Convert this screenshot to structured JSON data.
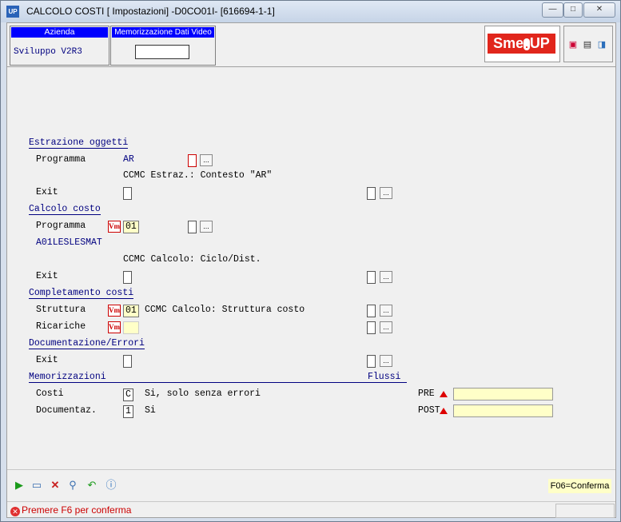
{
  "window": {
    "app_icon": "UP",
    "title": "CALCOLO COSTI [ Impostazioni] -D0CO01I- [616694-1-1]",
    "minimize": "—",
    "maximize": "□",
    "close": "✕"
  },
  "header": {
    "azienda_label": "Azienda",
    "azienda_value": "Sviluppo V2R3",
    "memo_label": "Memorizzazione Dati Video",
    "memo_value": "",
    "logo_text_left": "Sme",
    "logo_text_right": "UP"
  },
  "sections": {
    "estrazione": {
      "title": "Estrazione oggetti",
      "programma_label": "Programma",
      "programma_value": "AR",
      "programma_desc": "CCMC Estraz.: Contesto \"AR\"",
      "exit_label": "Exit"
    },
    "calcolo": {
      "title": "Calcolo costo",
      "programma_label": "Programma",
      "programma_value": "01",
      "programma_code": "A01LESLESMAT",
      "programma_desc": "CCMC Calcolo: Ciclo/Dist.",
      "exit_label": "Exit"
    },
    "completamento": {
      "title": "Completamento costi",
      "struttura_label": "Struttura",
      "struttura_value": "01",
      "struttura_desc": "CCMC Calcolo: Struttura costo",
      "ricariche_label": "Ricariche",
      "ricariche_value": ""
    },
    "documentazione": {
      "title": "Documentazione/Errori",
      "exit_label": "Exit"
    },
    "memorizzazioni": {
      "title": "Memorizzazioni",
      "flussi_label": "Flussi",
      "costi_label": "Costi",
      "costi_value": "C",
      "costi_desc": "Si, solo senza errori",
      "doc_label": "Documentaz.",
      "doc_value": "1",
      "doc_desc": "Si",
      "pre_label": "PRE",
      "pre_value": "",
      "post_label": "POST",
      "post_value": ""
    }
  },
  "icons": {
    "vm": "Vm",
    "dots": "..."
  },
  "footer": {
    "fkey": "F06=Conferma"
  },
  "status": {
    "message": "Premere F6 per conferma"
  }
}
